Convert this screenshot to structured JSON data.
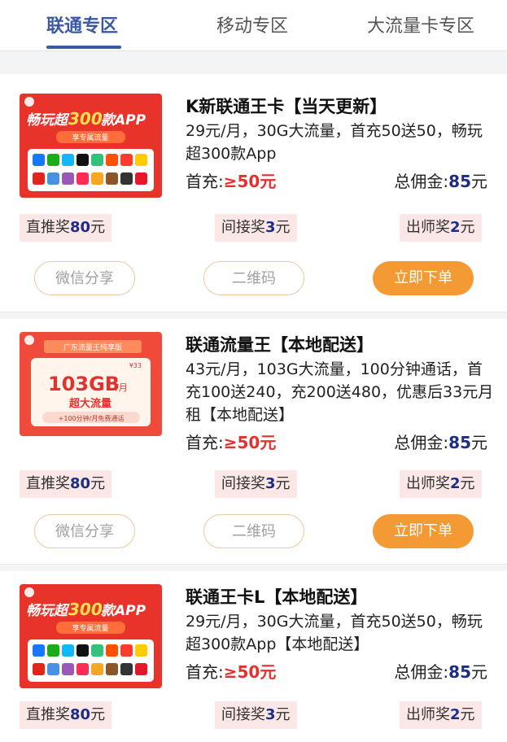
{
  "tabs": [
    {
      "label": "联通专区",
      "active": true
    },
    {
      "label": "移动专区",
      "active": false
    },
    {
      "label": "大流量卡专区",
      "active": false
    }
  ],
  "colors": {
    "accent": "#3b5aa6",
    "price": "#e5312e",
    "commission": "#1d2d86",
    "order_button": "#f39a35"
  },
  "products": [
    {
      "title": "K新联通王卡【当天更新】",
      "desc": "29元/月，30G大流量，首充50送50，畅玩超300款App",
      "first_label": "首充:",
      "first_value": "≥50元",
      "total_label": "总佣金:",
      "total_value": "85",
      "total_unit": "元",
      "direct_label": "直推奖",
      "direct_value": "80",
      "direct_unit": "元",
      "indirect_label": "间接奖",
      "indirect_value": "3",
      "indirect_unit": "元",
      "mentor_label": "出师奖",
      "mentor_value": "2",
      "mentor_unit": "元",
      "btn_share": "微信分享",
      "btn_qr": "二维码",
      "btn_order": "立即下单",
      "image": {
        "headline_pre": "畅玩超",
        "headline_num": "300",
        "headline_post": "款APP",
        "subtitle": "享专属流量"
      }
    },
    {
      "title": "联通流量王【本地配送】",
      "desc": "43元/月，103G大流量，100分钟通话，首充100送240，充200送480，优惠后33元月租【本地配送】",
      "first_label": "首充:",
      "first_value": "≥50元",
      "total_label": "总佣金:",
      "total_value": "85",
      "total_unit": "元",
      "direct_label": "直推奖",
      "direct_value": "80",
      "direct_unit": "元",
      "indirect_label": "间接奖",
      "indirect_value": "3",
      "indirect_unit": "元",
      "mentor_label": "出师奖",
      "mentor_value": "2",
      "mentor_unit": "元",
      "btn_share": "微信分享",
      "btn_qr": "二维码",
      "btn_order": "立即下单",
      "image": {
        "banner": "广东流量王纯享版",
        "price_tag": "¥33",
        "big": "103GB",
        "per": "/月",
        "subtitle": "超大流量",
        "note": "+100分钟/月免费通话"
      }
    },
    {
      "title": "联通王卡L【本地配送】",
      "desc": "29元/月，30G大流量，首充50送50，畅玩超300款App【本地配送】",
      "first_label": "首充:",
      "first_value": "≥50元",
      "total_label": "总佣金:",
      "total_value": "85",
      "total_unit": "元",
      "direct_label": "直推奖",
      "direct_value": "80",
      "direct_unit": "元",
      "indirect_label": "间接奖",
      "indirect_value": "3",
      "indirect_unit": "元",
      "mentor_label": "出师奖",
      "mentor_value": "2",
      "mentor_unit": "元",
      "image": {
        "headline_pre": "畅玩超",
        "headline_num": "300",
        "headline_post": "款APP",
        "subtitle": "享专属流量"
      }
    }
  ]
}
